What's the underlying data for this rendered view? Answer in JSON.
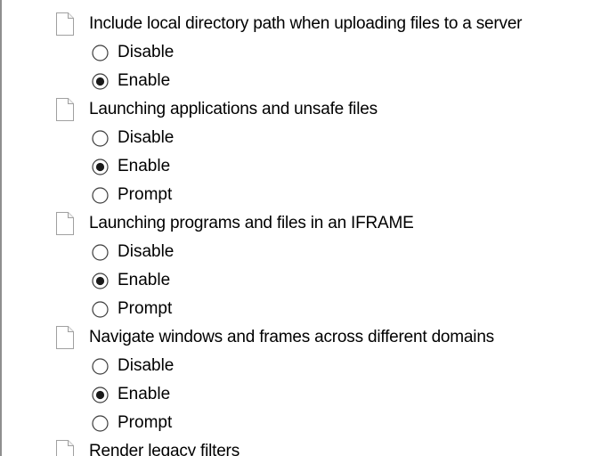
{
  "settings": [
    {
      "label": "Include local directory path when uploading files to a server",
      "icon": "document-icon",
      "options": [
        {
          "label": "Disable",
          "selected": false
        },
        {
          "label": "Enable",
          "selected": true
        }
      ]
    },
    {
      "label": "Launching applications and unsafe files",
      "icon": "document-icon",
      "options": [
        {
          "label": "Disable",
          "selected": false
        },
        {
          "label": "Enable",
          "selected": true
        },
        {
          "label": "Prompt",
          "selected": false
        }
      ]
    },
    {
      "label": "Launching programs and files in an IFRAME",
      "icon": "document-icon",
      "options": [
        {
          "label": "Disable",
          "selected": false
        },
        {
          "label": "Enable",
          "selected": true
        },
        {
          "label": "Prompt",
          "selected": false
        }
      ]
    },
    {
      "label": "Navigate windows and frames across different domains",
      "icon": "document-icon",
      "options": [
        {
          "label": "Disable",
          "selected": false
        },
        {
          "label": "Enable",
          "selected": true
        },
        {
          "label": "Prompt",
          "selected": false
        }
      ]
    },
    {
      "label": "Render legacy filters",
      "icon": "document-icon",
      "options": []
    }
  ],
  "colors": {
    "frame_border": "#8f8f8f",
    "radio_border": "#3c3c3c",
    "radio_dot": "#1a1a1a",
    "icon_border": "#a0a0a0"
  }
}
